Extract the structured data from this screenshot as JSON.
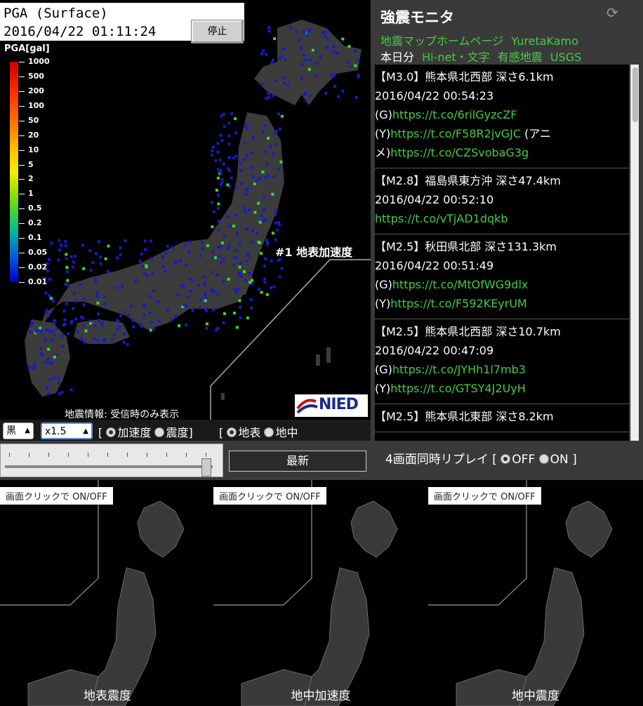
{
  "header": {
    "title": "PGA (Surface)",
    "timestamp": "2016/04/22 01:11:24",
    "stop_label": "停止"
  },
  "legend": {
    "title": "PGA[gal]",
    "levels": [
      "1000",
      "500",
      "200",
      "100",
      "50",
      "20",
      "10",
      "5",
      "2",
      "1",
      "0.5",
      "0.2",
      "0.1",
      "0.05",
      "0.02",
      "0.01"
    ]
  },
  "map": {
    "label": "#1 地表加速度",
    "info_note": "地震情報: 受信時のみ表示",
    "logo_text": "NIED"
  },
  "monitor": {
    "title": "強震モニタ",
    "links_row1": [
      "地震マップホームページ",
      "YuretaKamo"
    ],
    "links_row2_prefix": "本日分",
    "links_row2": [
      "Hi-net・文字",
      "有感地震",
      "USGS"
    ],
    "feed": [
      {
        "header": "【M3.0】熊本県北西部 深さ6.1km",
        "time": "2016/04/22 00:54:23",
        "lines": [
          {
            "prefix": "(G)",
            "link": "https://t.co/6rilGyzcZF",
            "suffix": ""
          },
          {
            "prefix": "(Y)",
            "link": "https://t.co/F58R2jvGJC",
            "suffix": " (アニ"
          },
          {
            "prefix": "メ)",
            "link": "https://t.co/CZSvobaG3g",
            "suffix": ""
          }
        ]
      },
      {
        "header": "【M2.8】福島県東方沖 深さ47.4km",
        "time": "2016/04/22 00:52:10",
        "lines": [
          {
            "prefix": "",
            "link": "https://t.co/vTjAD1dqkb",
            "suffix": ""
          }
        ]
      },
      {
        "header": "【M2.5】秋田県北部 深さ131.3km",
        "time": "2016/04/22 00:51:49",
        "lines": [
          {
            "prefix": "(G)",
            "link": "https://t.co/MtOfWG9dlx",
            "suffix": ""
          },
          {
            "prefix": "(Y)",
            "link": "https://t.co/F592KEyrUM",
            "suffix": ""
          }
        ]
      },
      {
        "header": "【M2.5】熊本県北西部 深さ10.7km",
        "time": "2016/04/22 00:47:09",
        "lines": [
          {
            "prefix": "(G)",
            "link": "https://t.co/JYHh1l7mb3",
            "suffix": ""
          },
          {
            "prefix": "(Y)",
            "link": "https://t.co/GTSY4J2UyH",
            "suffix": ""
          }
        ]
      },
      {
        "header": "【M2.5】熊本県北東部 深さ8.2km",
        "time": "",
        "lines": []
      }
    ]
  },
  "controls": {
    "color_select": "黒",
    "zoom_select": "x1.5",
    "bracket_open": "[",
    "bracket_close": "]",
    "radio_accel": "加速度",
    "radio_intensity": "震度",
    "radio_surface": "地表",
    "radio_underground": "地中",
    "latest_label": "最新",
    "replay_label": "4画面同時リプレイ",
    "replay_off": "OFF",
    "replay_on": "ON"
  },
  "panels": [
    {
      "note": "画面クリックで ON/OFF",
      "label": "地表震度"
    },
    {
      "note": "画面クリックで ON/OFF",
      "label": "地中加速度"
    },
    {
      "note": "画面クリックで ON/OFF",
      "label": "地中震度"
    }
  ],
  "colors": {
    "station": "#1a1acc",
    "station_active": "#33dd33",
    "land": "#3c3c3c",
    "link": "#44cc44"
  }
}
